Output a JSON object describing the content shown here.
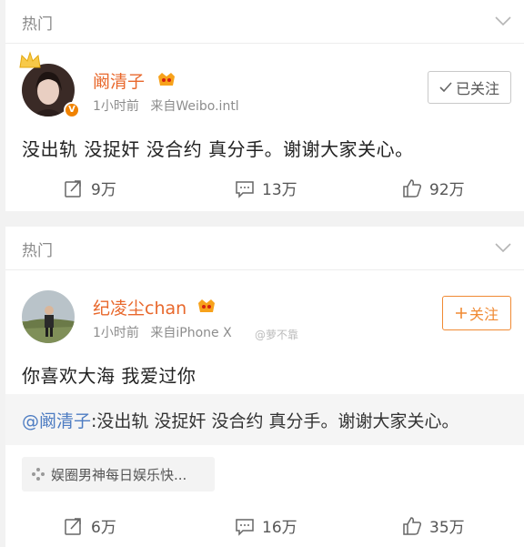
{
  "posts": [
    {
      "section_title": "热门",
      "user": "阚清子",
      "time": "1小时前",
      "source": "来自Weibo.intl",
      "follow_label": "已关注",
      "text": "没出轨 没捉奸 没合约 真分手。谢谢大家关心。",
      "repost_count": "9万",
      "comment_count": "13万",
      "like_count": "92万"
    },
    {
      "section_title": "热门",
      "user": "纪凌尘chan",
      "time": "1小时前",
      "source": "来自iPhone X",
      "follow_label": "关注",
      "text": "你喜欢大海 我爱过你",
      "repost_mention": "@阚清子",
      "repost_body": ":没出轨 没捉奸 没合约 真分手。谢谢大家关心。",
      "source_chip": "娱圈男神每日娱乐快...",
      "watermark": "@萝不靠",
      "repost_count": "6万",
      "comment_count": "16万",
      "like_count": "35万"
    }
  ],
  "colors": {
    "username": "#e8682c",
    "mention": "#4d7cc2",
    "follow": "#f08a33",
    "badge": "#f08200"
  },
  "icons": [
    "chevron-down-icon",
    "crown-icon",
    "verified-badge-icon",
    "vip-icon",
    "check-icon",
    "plus-icon",
    "repost-icon",
    "comment-icon",
    "like-icon",
    "source-icon"
  ]
}
